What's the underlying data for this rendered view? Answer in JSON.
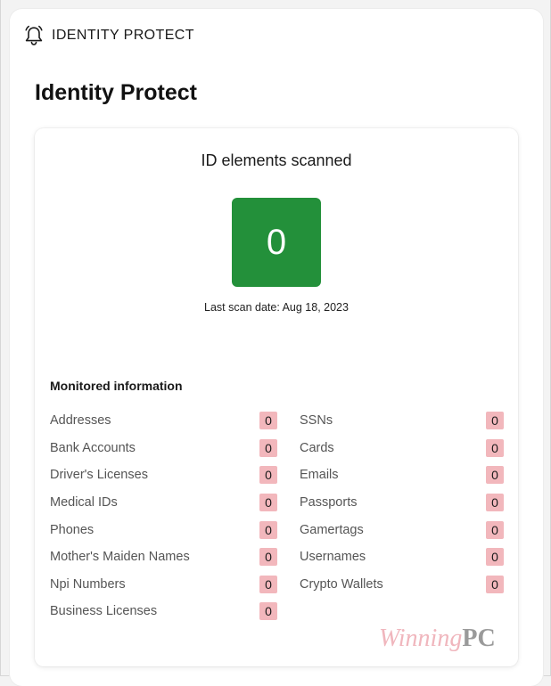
{
  "header": {
    "icon": "bell-icon",
    "title": "IDENTITY PROTECT"
  },
  "page": {
    "title": "Identity Protect"
  },
  "scan_card": {
    "title": "ID elements scanned",
    "count": "0",
    "count_color": "#23903a",
    "last_scan": "Last scan date: Aug 18, 2023"
  },
  "monitored": {
    "heading": "Monitored information",
    "badge_color": "#f2b7bc",
    "left_items": [
      {
        "label": "Addresses",
        "count": "0"
      },
      {
        "label": "Bank Accounts",
        "count": "0"
      },
      {
        "label": "Driver's Licenses",
        "count": "0"
      },
      {
        "label": "Medical IDs",
        "count": "0"
      },
      {
        "label": "Phones",
        "count": "0"
      },
      {
        "label": "Mother's Maiden Names",
        "count": "0"
      },
      {
        "label": "Npi Numbers",
        "count": "0"
      },
      {
        "label": "Business Licenses",
        "count": "0"
      }
    ],
    "right_items": [
      {
        "label": "SSNs",
        "count": "0"
      },
      {
        "label": "Cards",
        "count": "0"
      },
      {
        "label": "Emails",
        "count": "0"
      },
      {
        "label": "Passports",
        "count": "0"
      },
      {
        "label": "Gamertags",
        "count": "0"
      },
      {
        "label": "Usernames",
        "count": "0"
      },
      {
        "label": "Crypto Wallets",
        "count": "0"
      }
    ]
  },
  "watermark": {
    "script_text": "Winning",
    "bold_text": "PC"
  }
}
